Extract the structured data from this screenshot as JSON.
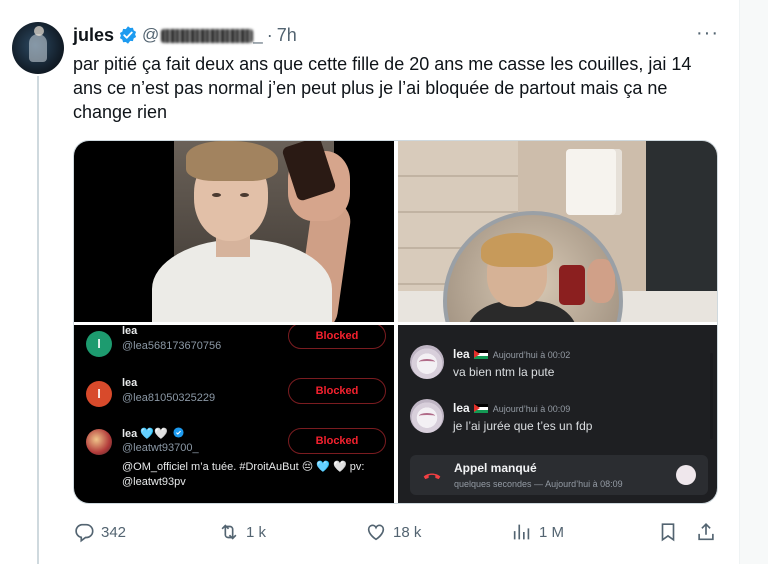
{
  "tweet": {
    "author_name": "jules",
    "handle_prefix": "@",
    "handle_suffix": "_",
    "dot": "·",
    "time": "7h",
    "more": "···",
    "text": "par pitié ça fait deux ans que cette fille de 20 ans me casse les couilles, jai 14 ans ce n’est pas normal j’en peut plus je l’ai bloquée de partout mais ça ne change rien"
  },
  "blocked_list": {
    "button_label": "Blocked",
    "rows": [
      {
        "initial": "l",
        "name": "lea",
        "handle": "@lea568173670756",
        "avatar_color": "#1d9b6f"
      },
      {
        "initial": "l",
        "name": "lea",
        "handle": "@lea81050325229",
        "avatar_color": "#d84a2b"
      },
      {
        "initial": "",
        "name": "lea 🩵🤍",
        "handle": "@leatwt93700_",
        "avatar_color": "#b23a3a",
        "bio_1": "@OM_officiel m’a tuée. #DroitAuBut 😔 🩵 🤍 pv:",
        "bio_2": "@leatwt93pv"
      }
    ]
  },
  "discord": {
    "messages": [
      {
        "author": "lea",
        "timestamp": "Aujourd’hui à 00:02",
        "text": "va bien ntm la pute"
      },
      {
        "author": "lea",
        "timestamp": "Aujourd’hui à 00:09",
        "text": "je l’ai jurée que t’es un fdp"
      }
    ],
    "call": {
      "title": "Appel manqué",
      "subtitle": "quelques secondes — Aujourd’hui à 08:09",
      "icon_color": "#f23f43"
    }
  },
  "actions": {
    "replies": "342",
    "reposts": "1 k",
    "likes": "18 k",
    "views": "1 M"
  },
  "colors": {
    "accent": "#1d9bf0",
    "muted": "#536471",
    "blocked": "#f4212e"
  }
}
